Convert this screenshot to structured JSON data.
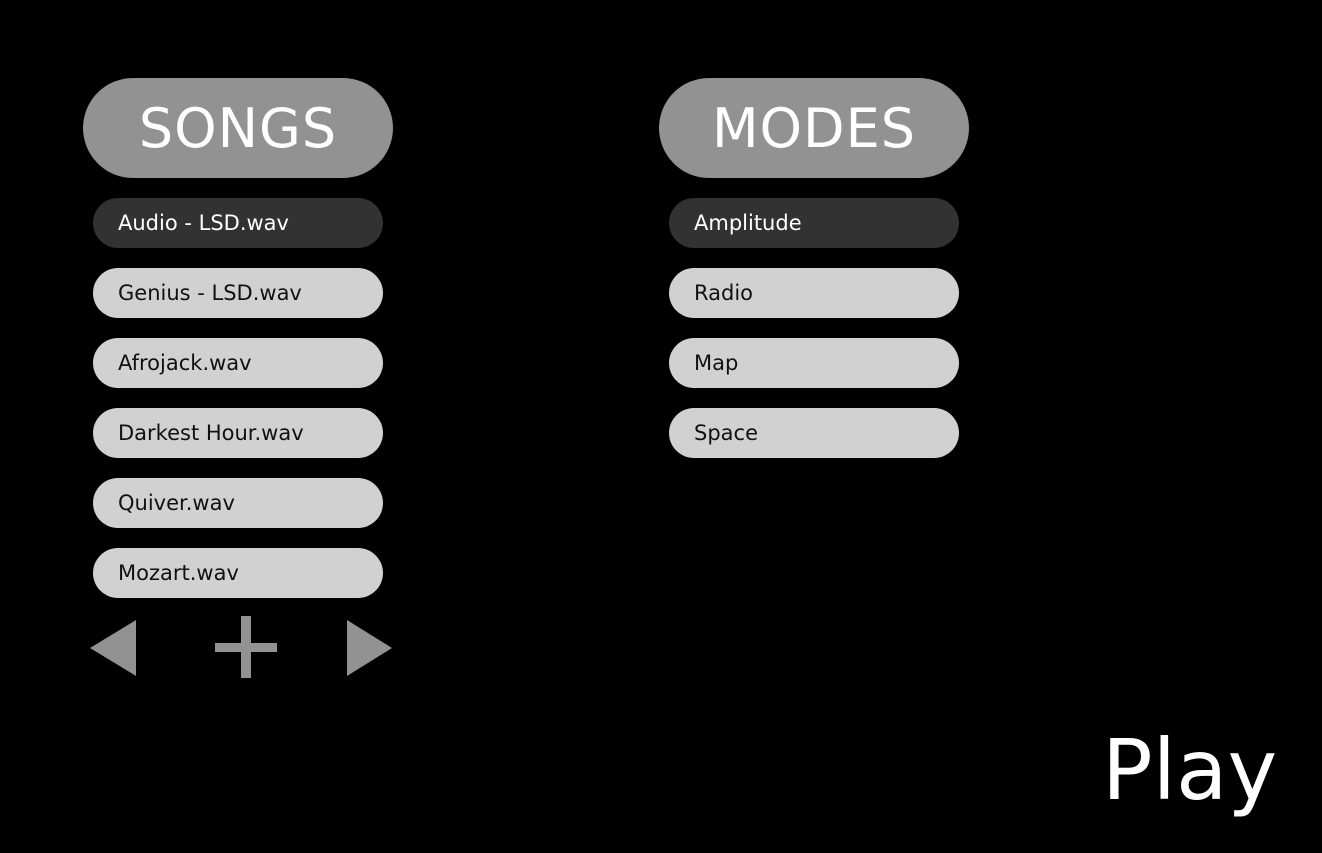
{
  "songs": {
    "title": "SONGS",
    "items": [
      {
        "label": "Audio - LSD.wav",
        "selected": true
      },
      {
        "label": "Genius - LSD.wav",
        "selected": false
      },
      {
        "label": "Afrojack.wav",
        "selected": false
      },
      {
        "label": "Darkest Hour.wav",
        "selected": false
      },
      {
        "label": "Quiver.wav",
        "selected": false
      },
      {
        "label": "Mozart.wav",
        "selected": false
      }
    ],
    "controls": {
      "prev_icon": "triangle-left-icon",
      "add_icon": "plus-icon",
      "next_icon": "triangle-right-icon"
    }
  },
  "modes": {
    "title": "MODES",
    "items": [
      {
        "label": "Amplitude",
        "selected": true
      },
      {
        "label": "Radio",
        "selected": false
      },
      {
        "label": "Map",
        "selected": false
      },
      {
        "label": "Space",
        "selected": false
      }
    ]
  },
  "play": {
    "label": "Play"
  },
  "colors": {
    "background": "#000000",
    "header_pill": "#929292",
    "item": "#d1d1d1",
    "item_selected": "#323232",
    "icon": "#929292"
  }
}
